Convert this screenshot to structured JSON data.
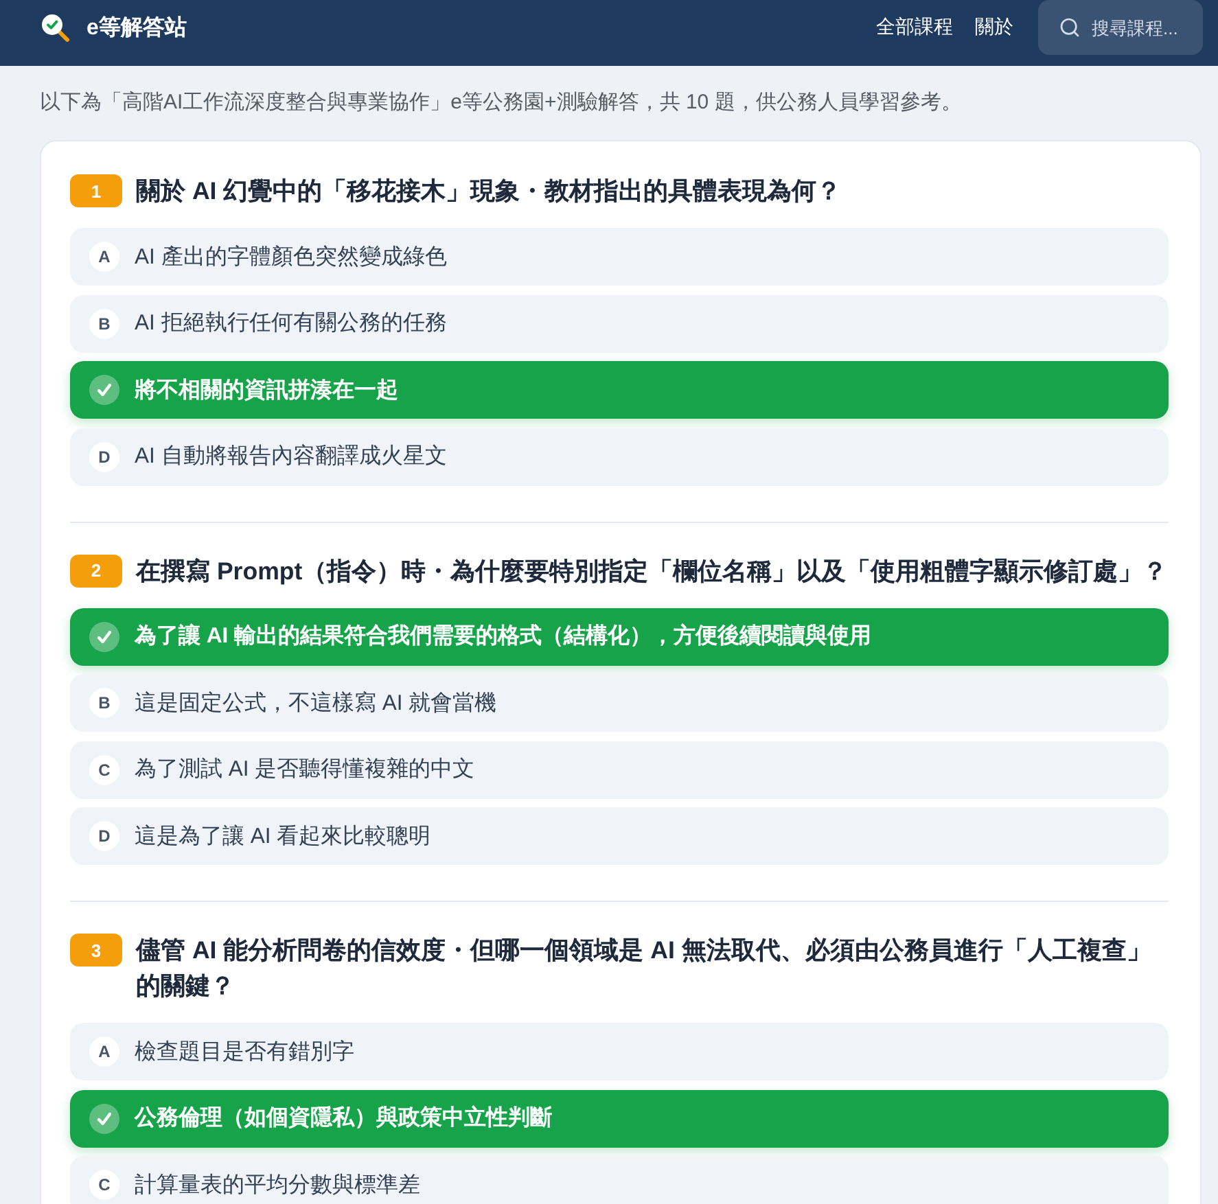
{
  "header": {
    "title": "e等解答站",
    "nav": [
      "全部課程",
      "關於"
    ],
    "search": {
      "placeholder": "搜尋課程..."
    }
  },
  "intro": "以下為「高階AI工作流深度整合與專業協作」e等公務園+測驗解答，共 10 題，供公務人員學習參考。",
  "questions": [
    {
      "number": "1",
      "text": "關於 AI 幻覺中的「移花接木」現象・教材指出的具體表現為何？",
      "options": [
        {
          "letter": "A",
          "text": "AI 產出的字體顏色突然變成綠色",
          "correct": false
        },
        {
          "letter": "B",
          "text": "AI 拒絕執行任何有關公務的任務",
          "correct": false
        },
        {
          "text": "將不相關的資訊拼湊在一起",
          "correct": true
        },
        {
          "letter": "D",
          "text": "AI 自動將報告內容翻譯成火星文",
          "correct": false
        }
      ]
    },
    {
      "number": "2",
      "text": "在撰寫 Prompt（指令）時・為什麼要特別指定「欄位名稱」以及「使用粗體字顯示修訂處」？",
      "options": [
        {
          "text": "為了讓 AI 輸出的結果符合我們需要的格式（結構化），方便後續閱讀與使用",
          "correct": true
        },
        {
          "letter": "B",
          "text": "這是固定公式，不這樣寫 AI 就會當機",
          "correct": false
        },
        {
          "letter": "C",
          "text": "為了測試 AI 是否聽得懂複雜的中文",
          "correct": false
        },
        {
          "letter": "D",
          "text": "這是為了讓 AI 看起來比較聰明",
          "correct": false
        }
      ]
    },
    {
      "number": "3",
      "text": "儘管 AI 能分析問卷的信效度・但哪一個領域是 AI 無法取代、必須由公務員進行「人工複查」的關鍵？",
      "options": [
        {
          "letter": "A",
          "text": "檢查題目是否有錯別字",
          "correct": false
        },
        {
          "text": "公務倫理（如個資隱私）與政策中立性判斷",
          "correct": true
        },
        {
          "letter": "C",
          "text": "計算量表的平均分數與標準差",
          "correct": false
        }
      ]
    }
  ]
}
